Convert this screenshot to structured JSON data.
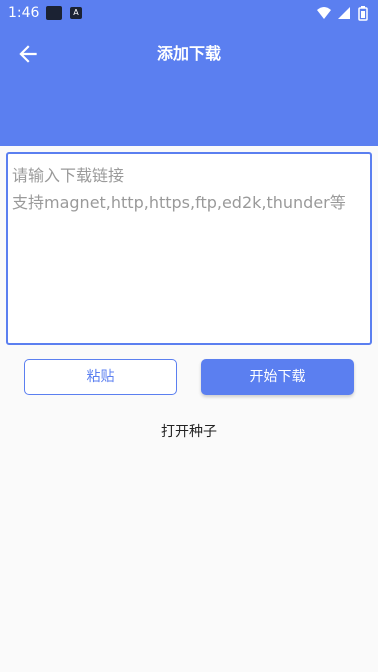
{
  "status_bar": {
    "time": "1:46",
    "notification_badge": "A",
    "icons": [
      "notification-square-icon",
      "notification-a-icon",
      "wifi-icon",
      "signal-icon",
      "battery-icon"
    ]
  },
  "app_bar": {
    "title": "添加下载",
    "back_icon": "arrow-left-icon"
  },
  "link_input": {
    "value": "",
    "placeholder": "请输入下载链接\n支持magnet,http,https,ftp,ed2k,thunder等"
  },
  "buttons": {
    "paste_label": "粘贴",
    "start_label": "开始下载"
  },
  "open_seed_label": "打开种子",
  "colors": {
    "primary": "#5b7ff0",
    "background": "#fafafa",
    "placeholder": "#9a9a9a"
  }
}
